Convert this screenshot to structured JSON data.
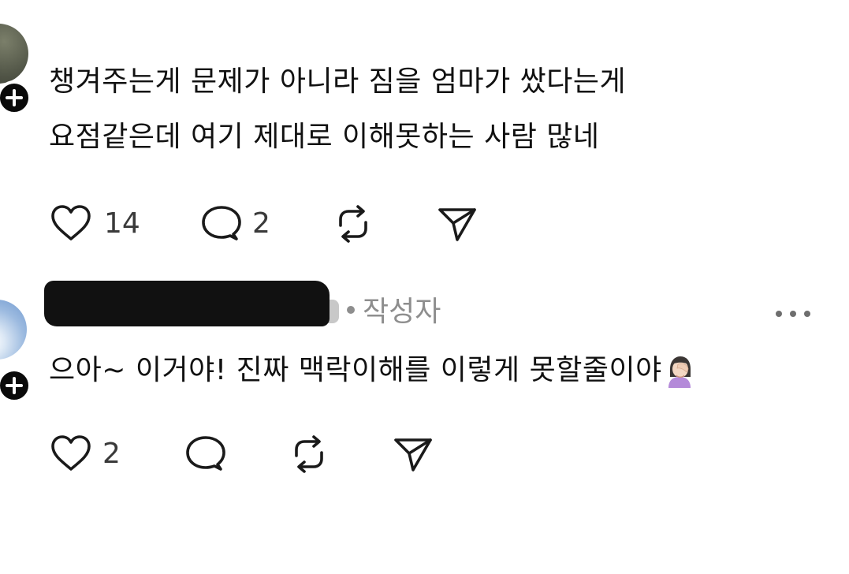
{
  "comment": {
    "line1": "챙겨주는게 문제가 아니라 짐을 엄마가 쌌다는게",
    "line2": "요점같은데 여기 제대로 이해못하는 사람 많네",
    "likes": "14",
    "replies": "2"
  },
  "reply": {
    "meta_author_tag": "작성자",
    "text": "으아~ 이거야! 진짜 맥락이해를 이렇게 못할줄이야",
    "emoji": "person-facepalming-emoji",
    "likes": "2"
  },
  "icons": {
    "like": "heart-icon",
    "reply": "comment-bubble-icon",
    "repost": "repost-icon",
    "share": "send-icon",
    "follow": "plus-icon",
    "more": "more-icon"
  },
  "colors": {
    "text": "#111111",
    "muted": "#8e8e8e",
    "icon": "#1a1a1a"
  }
}
